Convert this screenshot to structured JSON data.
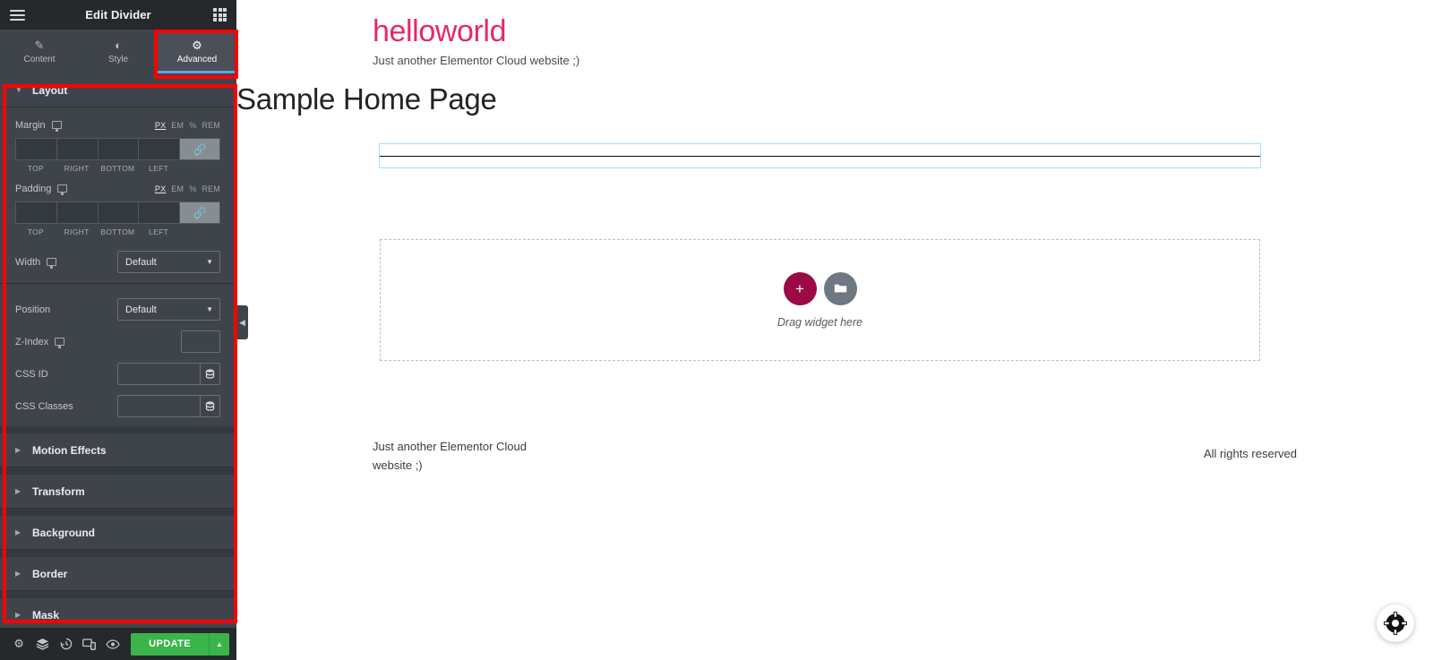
{
  "panel": {
    "header": {
      "title": "Edit Divider",
      "menu_icon": "hamburger-menu-icon",
      "widgets_icon": "widgets-grid-icon"
    },
    "tabs": [
      {
        "label": "Content",
        "icon": "pencil-icon",
        "active": false
      },
      {
        "label": "Style",
        "icon": "contrast-half-circle-icon",
        "active": false
      },
      {
        "label": "Advanced",
        "icon": "gear-icon",
        "active": true
      }
    ],
    "sections": [
      {
        "label": "Layout",
        "expanded": true
      },
      {
        "label": "Motion Effects",
        "expanded": false
      },
      {
        "label": "Transform",
        "expanded": false
      },
      {
        "label": "Background",
        "expanded": false
      },
      {
        "label": "Border",
        "expanded": false
      },
      {
        "label": "Mask",
        "expanded": false
      }
    ],
    "layout": {
      "margin": {
        "label": "Margin",
        "units": [
          "PX",
          "EM",
          "%",
          "REM"
        ],
        "active_unit": "PX",
        "values": [
          "",
          "",
          "",
          ""
        ],
        "side_labels": [
          "TOP",
          "RIGHT",
          "BOTTOM",
          "LEFT"
        ],
        "link_icon": "link-chain-icon"
      },
      "padding": {
        "label": "Padding",
        "units": [
          "PX",
          "EM",
          "%",
          "REM"
        ],
        "active_unit": "PX",
        "values": [
          "",
          "",
          "",
          ""
        ],
        "side_labels": [
          "TOP",
          "RIGHT",
          "BOTTOM",
          "LEFT"
        ],
        "link_icon": "link-chain-icon"
      },
      "width": {
        "label": "Width",
        "value": "Default"
      },
      "position": {
        "label": "Position",
        "value": "Default"
      },
      "z_index": {
        "label": "Z-Index",
        "value": ""
      },
      "css_id": {
        "label": "CSS ID",
        "value": "",
        "dynamic_icon": "dynamic-tags-icon"
      },
      "css_classes": {
        "label": "CSS Classes",
        "value": "",
        "dynamic_icon": "dynamic-tags-icon"
      }
    },
    "footer": {
      "icons": [
        {
          "name": "settings-gear-icon"
        },
        {
          "name": "navigator-layers-icon"
        },
        {
          "name": "history-clock-icon"
        },
        {
          "name": "responsive-mode-icon"
        },
        {
          "name": "preview-eye-icon"
        }
      ],
      "update_label": "UPDATE",
      "update_caret": "caret-up-icon"
    },
    "collapse_handle": "panel-collapse-arrow-icon",
    "accent_color": "#59a6e8",
    "update_color": "#39b54a",
    "annotation_color": "#ff0000"
  },
  "canvas": {
    "site_title": "helloworld",
    "site_tagline": "Just another Elementor Cloud website ;)",
    "page_title": "Sample Home Page",
    "divider_widget": {
      "name": "divider-widget",
      "selected": true
    },
    "drop_area": {
      "add_button_icon": "plus-icon",
      "folder_button_icon": "folder-template-icon",
      "label": "Drag widget here"
    },
    "footer": {
      "left_text": "Just another Elementor Cloud website ;)",
      "right_text": "All rights reserved"
    },
    "help_fab_icon": "lifebuoy-help-icon",
    "title_color": "#e5276d",
    "selection_color": "#a9dcf5",
    "add_button_color": "#9b0a46"
  }
}
